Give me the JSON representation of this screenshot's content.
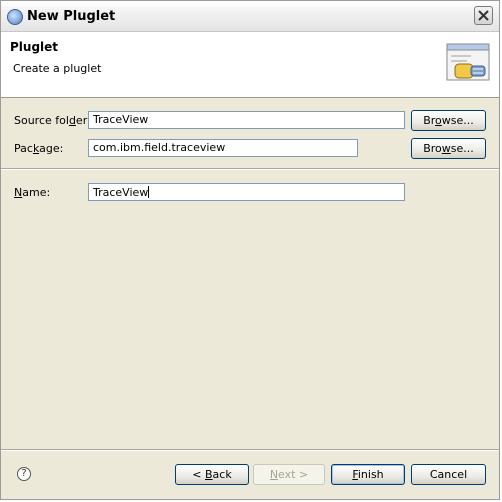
{
  "window": {
    "title": "New Pluglet"
  },
  "header": {
    "title": "Pluglet",
    "subtitle": "Create a pluglet"
  },
  "form": {
    "source_folder": {
      "label_pre": "Source fol",
      "label_mn": "d",
      "label_post": "er:",
      "value": "TraceView"
    },
    "package": {
      "label_pre": "Pac",
      "label_mn": "k",
      "label_post": "age:",
      "value": "com.ibm.field.traceview"
    },
    "name": {
      "label_pre": "",
      "label_mn": "N",
      "label_post": "ame:",
      "value": "TraceView"
    },
    "browse_1": {
      "pre": "Br",
      "mn": "o",
      "post": "wse..."
    },
    "browse_2": {
      "pre": "Bro",
      "mn": "w",
      "post": "se..."
    }
  },
  "footer": {
    "help_icon": "?",
    "back": {
      "pre": "< ",
      "mn": "B",
      "post": "ack"
    },
    "next": {
      "pre": "",
      "mn": "N",
      "post": "ext >"
    },
    "finish": {
      "pre": "",
      "mn": "F",
      "post": "inish"
    },
    "cancel": "Cancel"
  },
  "colors": {
    "titlebar": "#ececec",
    "field_border": "#7f9db9",
    "button_border": "#003c74"
  }
}
